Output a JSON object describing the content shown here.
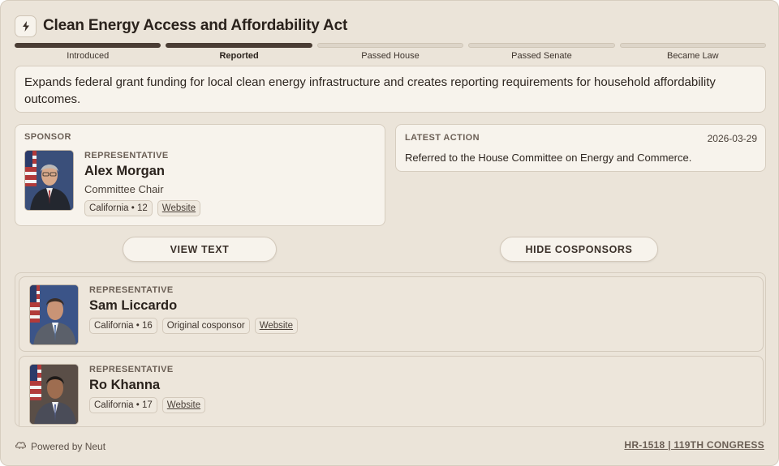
{
  "bill": {
    "title": "Clean Energy Access and Affordability Act",
    "summary": "Expands federal grant funding for local clean energy infrastructure and creates reporting requirements for household affordability outcomes."
  },
  "progress": {
    "stages": [
      {
        "label": "Introduced",
        "done": true,
        "current": false
      },
      {
        "label": "Reported",
        "done": true,
        "current": true
      },
      {
        "label": "Passed House",
        "done": false,
        "current": false
      },
      {
        "label": "Passed Senate",
        "done": false,
        "current": false
      },
      {
        "label": "Became Law",
        "done": false,
        "current": false
      }
    ]
  },
  "sponsor": {
    "caption": "SPONSOR",
    "role": "REPRESENTATIVE",
    "name": "Alex Morgan",
    "title": "Committee Chair",
    "district": "California • 12",
    "website_label": "Website"
  },
  "latest_action": {
    "caption": "LATEST ACTION",
    "date": "2026-03-29",
    "text": "Referred to the House Committee on Energy and Commerce."
  },
  "buttons": {
    "view_text": "VIEW TEXT",
    "hide_cosponsors": "HIDE COSPONSORS"
  },
  "cosponsors": [
    {
      "role": "REPRESENTATIVE",
      "name": "Sam Liccardo",
      "district": "California • 16",
      "tag": "Original cosponsor",
      "website_label": "Website"
    },
    {
      "role": "REPRESENTATIVE",
      "name": "Ro Khanna",
      "district": "California • 17",
      "tag": "",
      "website_label": "Website"
    }
  ],
  "footer": {
    "powered_by": "Powered by Neut",
    "bill_ref": "HR-1518 | 119TH CONGRESS"
  },
  "colors": {
    "background": "#ebe4d9",
    "panel": "#f7f3ec",
    "progress_done": "#4a3d34",
    "progress_pending": "#ddd5c9"
  },
  "icons": {
    "header": "lightning-bolt-icon",
    "footer": "neut-logo-icon"
  }
}
